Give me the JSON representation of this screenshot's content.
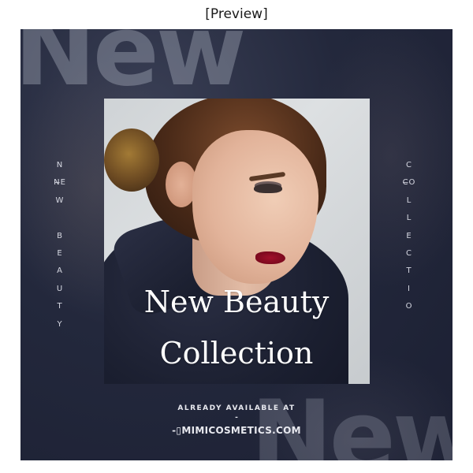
{
  "preview": {
    "title": "[Preview]"
  },
  "banner": {
    "bg_word_top": "New",
    "bg_word_bottom": "New",
    "left_vertical": [
      "N",
      "N̶E",
      "W",
      "",
      "B",
      "E",
      "A",
      "U",
      "T",
      "Y"
    ],
    "right_vertical": [
      "C",
      "C̶O",
      "L",
      "L",
      "E",
      "C",
      "T",
      "I",
      "O"
    ],
    "headline_line1": "New Beauty",
    "headline_line2": "Collection",
    "available_text": "ALREADY AVAILABLE AT",
    "separator": "-",
    "website": "-▯MIMICOSMETICS.COM"
  },
  "colors": {
    "background": "#23283c",
    "text": "#ffffff"
  }
}
